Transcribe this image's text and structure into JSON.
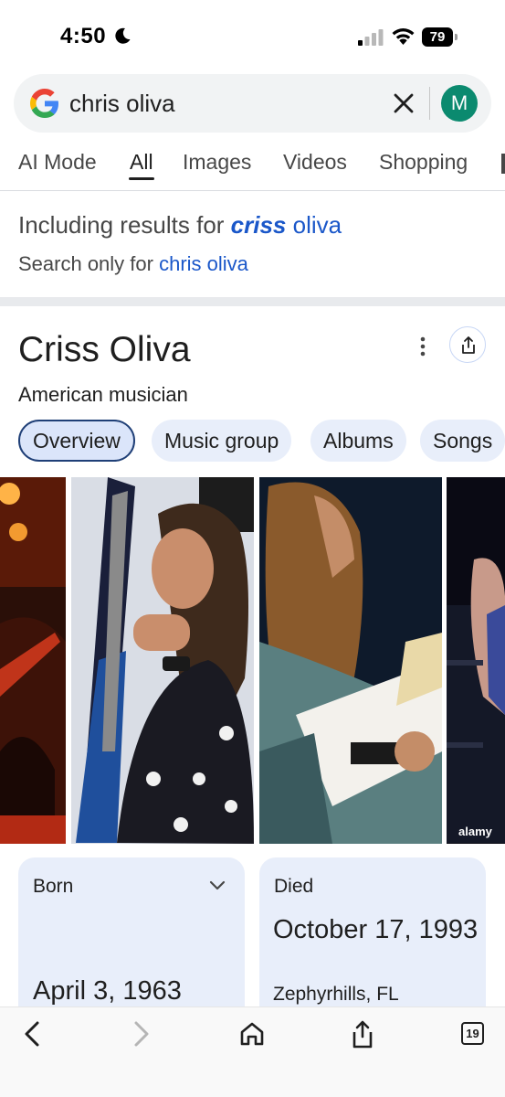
{
  "status_bar": {
    "time": "4:50",
    "battery": "79"
  },
  "search": {
    "query": "chris oliva",
    "avatar_initial": "M"
  },
  "tabs": [
    {
      "label": "AI Mode"
    },
    {
      "label": "All"
    },
    {
      "label": "Images"
    },
    {
      "label": "Videos"
    },
    {
      "label": "Shopping"
    }
  ],
  "spelling": {
    "including_prefix": "Including results for ",
    "corrected_term": "criss",
    "corrected_rest": " oliva",
    "search_only_prefix": "Search only for ",
    "original_query": "chris oliva"
  },
  "knowledge_panel": {
    "title": "Criss Oliva",
    "subtitle": "American musician",
    "chips": [
      {
        "label": "Overview"
      },
      {
        "label": "Music group"
      },
      {
        "label": "Albums"
      },
      {
        "label": "Songs"
      }
    ],
    "image_watermark": "alamy",
    "born": {
      "label": "Born",
      "value": "April 3, 1963"
    },
    "died": {
      "label": "Died",
      "value": "October 17, 1993",
      "place": "Zephyrhills, FL"
    }
  },
  "bottom_nav": {
    "tab_count": "19"
  },
  "colors": {
    "link": "#1a57c9",
    "avatar": "#0b8a6f",
    "card_bg": "#e8eefa"
  }
}
